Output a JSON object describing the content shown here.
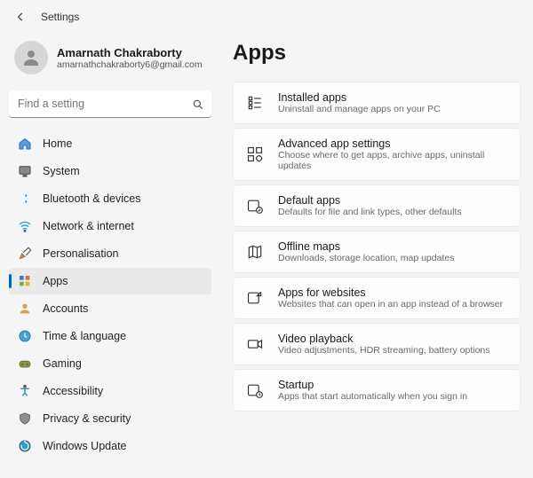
{
  "window": {
    "title": "Settings"
  },
  "profile": {
    "name": "Amarnath Chakraborty",
    "email": "amarnathchakraborty6@gmail.com"
  },
  "search": {
    "placeholder": "Find a setting"
  },
  "nav": {
    "items": [
      {
        "label": "Home",
        "icon": "home",
        "selected": false
      },
      {
        "label": "System",
        "icon": "system",
        "selected": false
      },
      {
        "label": "Bluetooth & devices",
        "icon": "bluetooth",
        "selected": false
      },
      {
        "label": "Network & internet",
        "icon": "wifi",
        "selected": false
      },
      {
        "label": "Personalisation",
        "icon": "brush",
        "selected": false
      },
      {
        "label": "Apps",
        "icon": "apps",
        "selected": true
      },
      {
        "label": "Accounts",
        "icon": "person",
        "selected": false
      },
      {
        "label": "Time & language",
        "icon": "clock",
        "selected": false
      },
      {
        "label": "Gaming",
        "icon": "gaming",
        "selected": false
      },
      {
        "label": "Accessibility",
        "icon": "accessibility",
        "selected": false
      },
      {
        "label": "Privacy & security",
        "icon": "shield",
        "selected": false
      },
      {
        "label": "Windows Update",
        "icon": "update",
        "selected": false
      }
    ]
  },
  "main": {
    "title": "Apps",
    "cards": [
      {
        "title": "Installed apps",
        "subtitle": "Uninstall and manage apps on your PC",
        "icon": "installed"
      },
      {
        "title": "Advanced app settings",
        "subtitle": "Choose where to get apps, archive apps, uninstall updates",
        "icon": "advanced"
      },
      {
        "title": "Default apps",
        "subtitle": "Defaults for file and link types, other defaults",
        "icon": "default"
      },
      {
        "title": "Offline maps",
        "subtitle": "Downloads, storage location, map updates",
        "icon": "maps"
      },
      {
        "title": "Apps for websites",
        "subtitle": "Websites that can open in an app instead of a browser",
        "icon": "websites"
      },
      {
        "title": "Video playback",
        "subtitle": "Video adjustments, HDR streaming, battery options",
        "icon": "video"
      },
      {
        "title": "Startup",
        "subtitle": "Apps that start automatically when you sign in",
        "icon": "startup"
      }
    ]
  },
  "colors": {
    "accent": "#0067c0",
    "arrow": "#e11b1b"
  }
}
